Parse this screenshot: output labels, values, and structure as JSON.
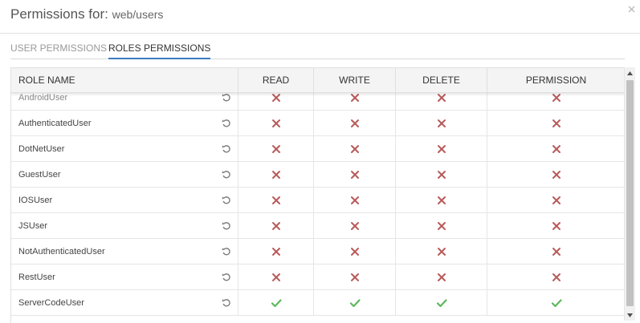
{
  "dialog": {
    "title_prefix": "Permissions for:",
    "title_path": "web/users"
  },
  "tabs": [
    {
      "label": "USER PERMISSIONS",
      "active": false
    },
    {
      "label": "ROLES PERMISSIONS",
      "active": true
    }
  ],
  "table": {
    "columns": [
      "ROLE NAME",
      "READ",
      "WRITE",
      "DELETE",
      "PERMISSION"
    ],
    "rows": [
      {
        "name": "AndroidUser",
        "perms": [
          "deny",
          "deny",
          "deny",
          "deny"
        ]
      },
      {
        "name": "AuthenticatedUser",
        "perms": [
          "deny",
          "deny",
          "deny",
          "deny"
        ]
      },
      {
        "name": "DotNetUser",
        "perms": [
          "deny",
          "deny",
          "deny",
          "deny"
        ]
      },
      {
        "name": "GuestUser",
        "perms": [
          "deny",
          "deny",
          "deny",
          "deny"
        ]
      },
      {
        "name": "IOSUser",
        "perms": [
          "deny",
          "deny",
          "deny",
          "deny"
        ]
      },
      {
        "name": "JSUser",
        "perms": [
          "deny",
          "deny",
          "deny",
          "deny"
        ]
      },
      {
        "name": "NotAuthenticatedUser",
        "perms": [
          "deny",
          "deny",
          "deny",
          "deny"
        ]
      },
      {
        "name": "RestUser",
        "perms": [
          "deny",
          "deny",
          "deny",
          "deny"
        ]
      },
      {
        "name": "ServerCodeUser",
        "perms": [
          "allow",
          "allow",
          "allow",
          "allow"
        ]
      }
    ]
  },
  "icons": {
    "close": "close-icon",
    "reset": "reset-icon",
    "allow": "check-icon",
    "deny": "cross-icon",
    "scroll_up": "arrow-up-icon",
    "scroll_down": "arrow-down-icon"
  },
  "colors": {
    "deny": "#b85a5a",
    "allow": "#5cb85c",
    "tab_active_underline": "#3a7bbd"
  }
}
